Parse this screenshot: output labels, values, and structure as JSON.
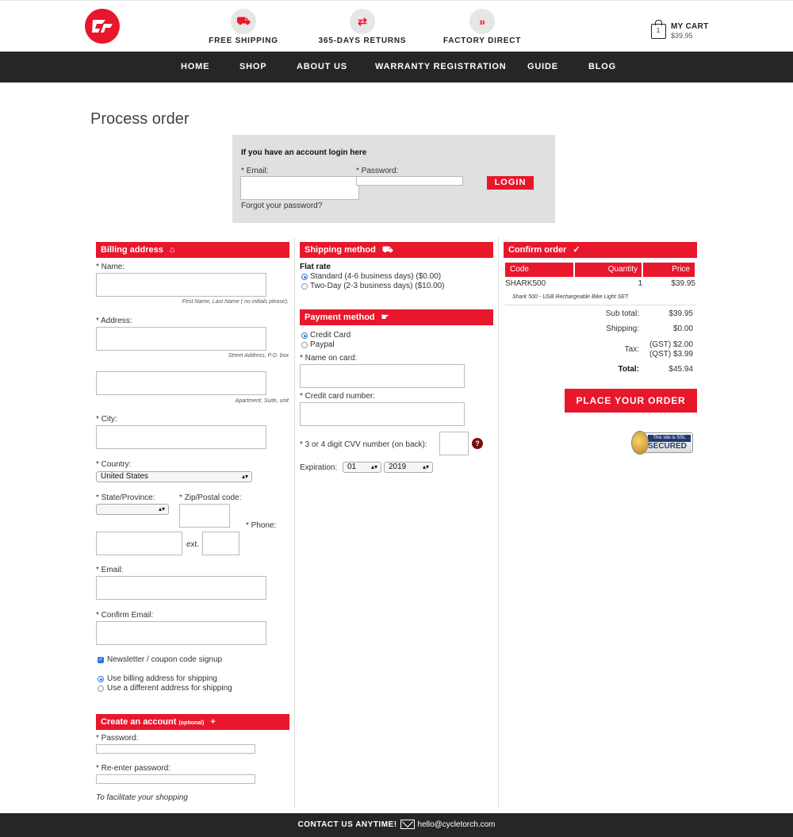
{
  "header": {
    "features": [
      {
        "label": "FREE SHIPPING",
        "icon": "truck-icon",
        "glyph": "⛟"
      },
      {
        "label": "365-DAYS RETURNS",
        "icon": "arrows-exchange-icon",
        "glyph": "⇄"
      },
      {
        "label": "FACTORY DIRECT",
        "icon": "double-chevron-icon",
        "glyph": "»"
      }
    ],
    "cart": {
      "title": "MY CART",
      "price": "$39.95",
      "count": "1"
    }
  },
  "nav": [
    "HOME",
    "SHOP",
    "ABOUT US",
    "WARRANTY REGISTRATION",
    "GUIDE",
    "BLOG"
  ],
  "page_title": "Process order",
  "login": {
    "heading": "If you have an account login here",
    "email_label": "* Email:",
    "password_label": "* Password:",
    "button": "LOGIN",
    "forgot": "Forgot your password?"
  },
  "billing": {
    "title": "Billing address",
    "name_label": "* Name:",
    "name_hint": "First Name, Last Name ( no initials please).",
    "address_label": "* Address:",
    "address_hint": "Street Address, P.O. box",
    "address2_hint": "Apartment, Suite, unit",
    "city_label": "* City:",
    "country_label": "* Country:",
    "country_value": "United States",
    "state_label": "* State/Province:",
    "zip_label": "* Zip/Postal code:",
    "phone_label": "* Phone:",
    "ext_label": "ext.",
    "email_label": "* Email:",
    "confirm_email_label": "* Confirm Email:",
    "newsletter": "Newsletter / coupon code signup",
    "ship_option_1": "Use billing address for shipping",
    "ship_option_2": "Use a different address for shipping"
  },
  "create_account": {
    "title": "Create an account",
    "optional": "(optional)",
    "password_label": "* Password:",
    "reenter_label": "* Re-enter password:",
    "note": "To facilitate your shopping"
  },
  "shipping": {
    "title": "Shipping method",
    "group": "Flat rate",
    "options": [
      "Standard (4-6 business days) ($0.00)",
      "Two-Day (2-3 business days) ($10.00)"
    ]
  },
  "payment": {
    "title": "Payment method",
    "options": [
      "Credit Card",
      "Paypal"
    ],
    "name_label": "* Name on card:",
    "number_label": "* Credit card number:",
    "cvv_label": "* 3 or 4 digit CVV number (on back):",
    "cvv_help": "?",
    "expiration_label": "Expiration:",
    "month": "01",
    "year": "2019"
  },
  "order": {
    "title": "Confirm order",
    "columns": [
      "Code",
      "Quantity",
      "Price"
    ],
    "item_code": "SHARK500",
    "item_qty": "1",
    "item_price": "$39.95",
    "item_desc": "Shark 500 - USB Rechargeable Bike Light SET",
    "subtotal_label": "Sub total:",
    "subtotal": "$39.95",
    "shipping_label": "Shipping:",
    "shipping": "$0.00",
    "tax_label": "Tax:",
    "tax_gst": "(GST) $2.00",
    "tax_qst": "(QST) $3.99",
    "total_label": "Total:",
    "total": "$45.94",
    "place_button": "PLACE YOUR ORDER",
    "ssl_top": "This site is SSL",
    "ssl_bottom": "SECURED"
  },
  "footer": {
    "contact": "CONTACT US ANYTIME!",
    "email": "hello@cycletorch.com"
  },
  "colors": {
    "accent": "#e8172c",
    "dark": "#262626",
    "radio": "#2b78e4"
  }
}
